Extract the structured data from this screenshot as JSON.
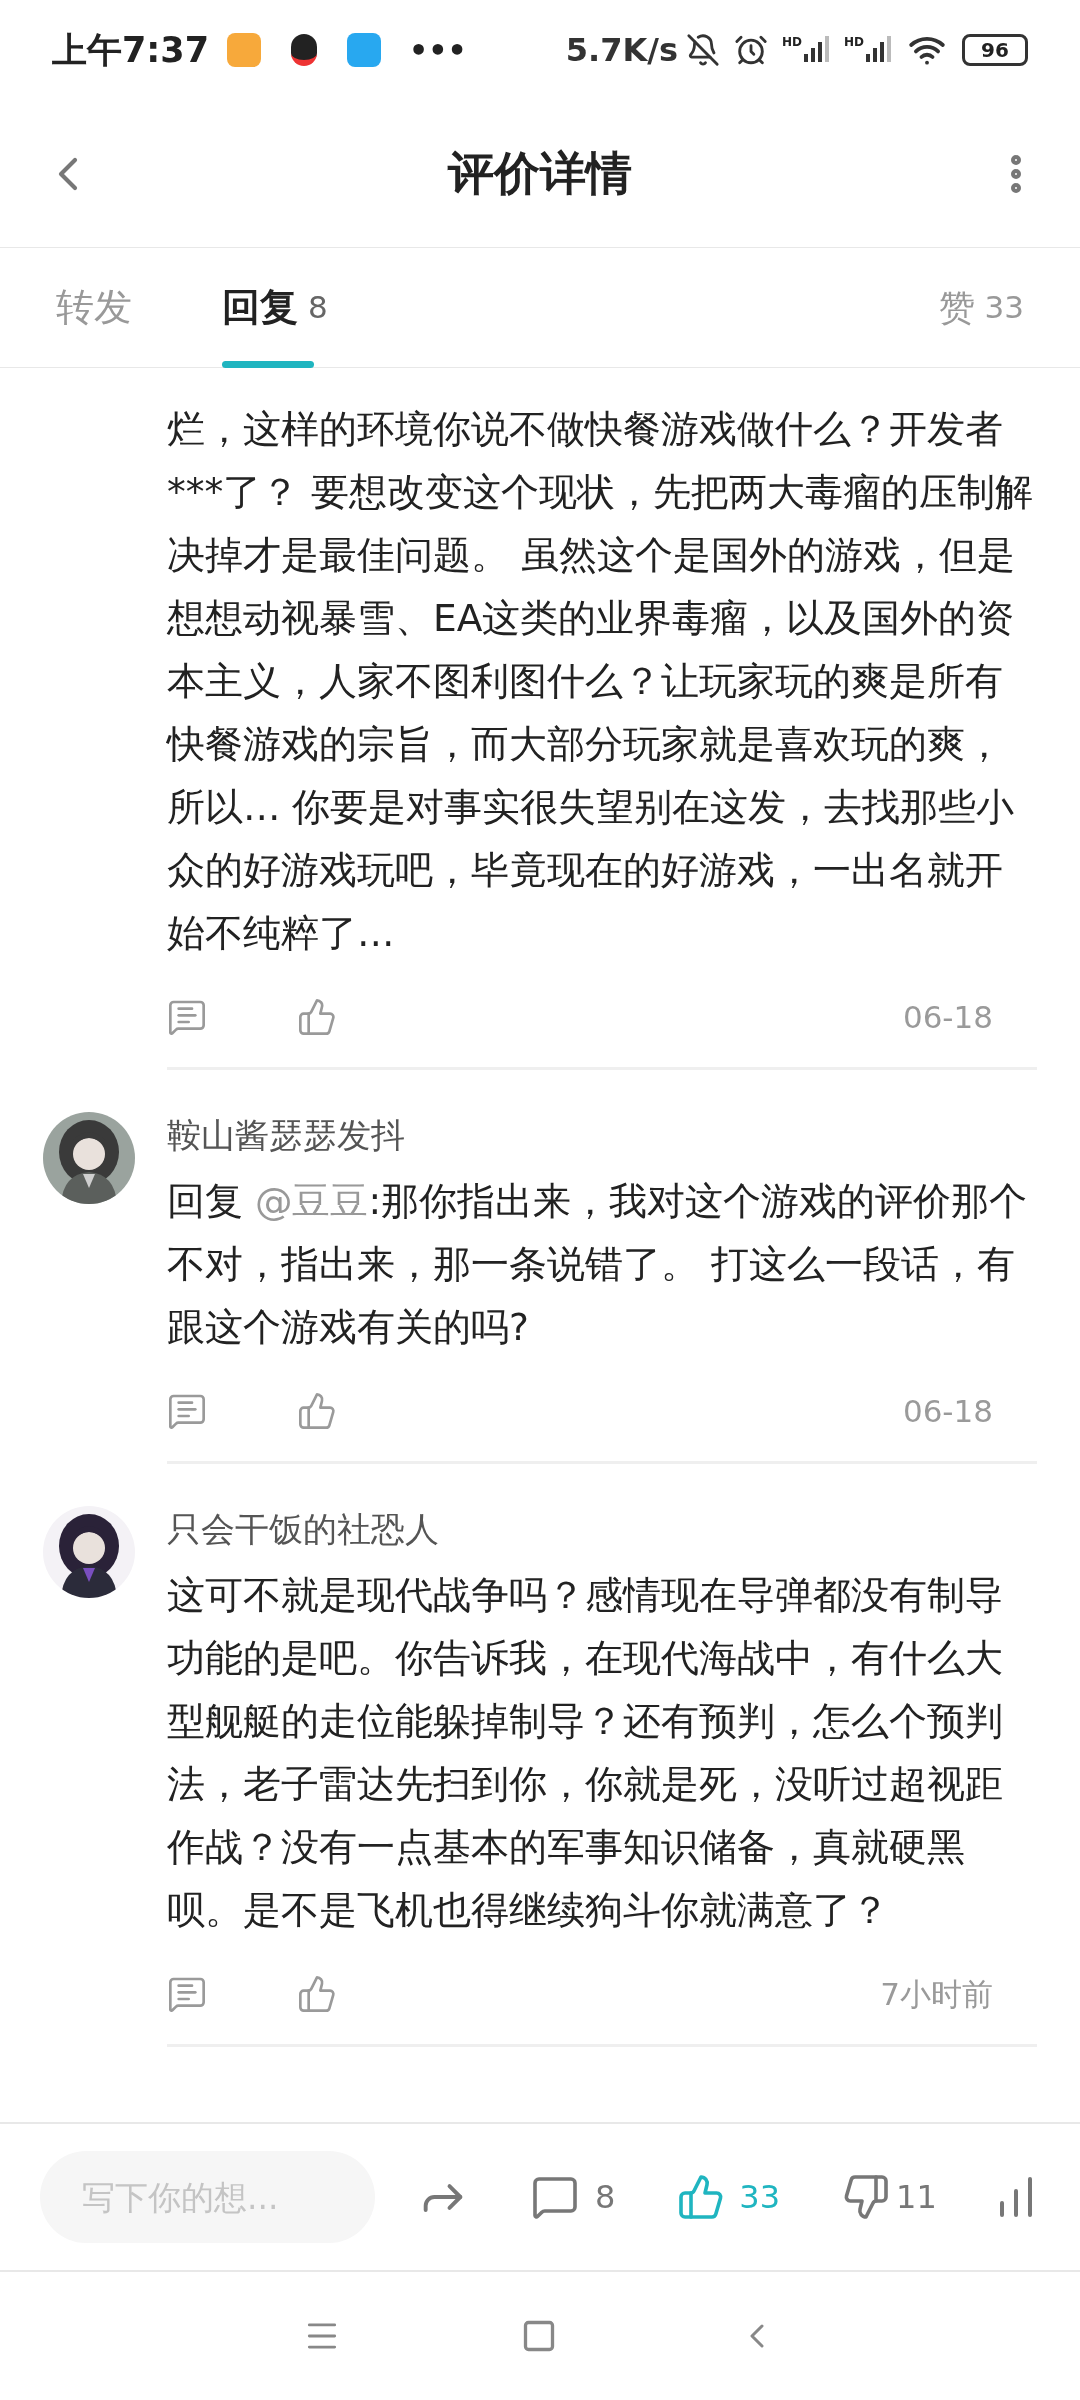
{
  "status_bar": {
    "time": "上午7:37",
    "more": "•••",
    "speed": "5.7K/s",
    "network_1": "HD",
    "network_2": "HD",
    "battery": "96"
  },
  "header": {
    "title": "评价详情"
  },
  "tabs": [
    {
      "label": "转发",
      "selected": false
    },
    {
      "label": "回复",
      "count": "8",
      "selected": true
    }
  ],
  "likes_tab": {
    "label": "赞",
    "count": "33"
  },
  "comments": [
    {
      "text": "烂，这样的环境你说不做快餐游戏做什么？开发者***了？ 要想改变这个现状，先把两大毒瘤的压制解决掉才是最佳问题。 虽然这个是国外的游戏，但是想想动视暴雪、EA这类的业界毒瘤，以及国外的资本主义，人家不图利图什么？让玩家玩的爽是所有快餐游戏的宗旨，而大部分玩家就是喜欢玩的爽，所以… 你要是对事实很失望别在这发，去找那些小众的好游戏玩吧，毕竟现在的好游戏，一出名就开始不纯粹了…",
      "time": "06-18"
    },
    {
      "user": "鞍山酱瑟瑟发抖",
      "reply_prefix": "回复",
      "mention": "@豆豆",
      "text": ":那你指出来，我对这个游戏的评价那个不对，指出来，那一条说错了。 打这么一段话，有跟这个游戏有关的吗?",
      "time": "06-18"
    },
    {
      "user": "只会干饭的社恐人",
      "text": "这可不就是现代战争吗？感情现在导弹都没有制导功能的是吧。你告诉我，在现代海战中，有什么大型舰艇的走位能躲掉制导？还有预判，怎么个预判法，老子雷达先扫到你，你就是死，没听过超视距作战？没有一点基本的军事知识储备，真就硬黑呗。是不是飞机也得继续狗斗你就满意了？",
      "time": "7小时前"
    }
  ],
  "bottom_bar": {
    "placeholder": "写下你的想...",
    "comments": "8",
    "likes": {
      "count": "33",
      "selected": true
    },
    "dislikes": {
      "count": "11",
      "selected": false
    }
  }
}
